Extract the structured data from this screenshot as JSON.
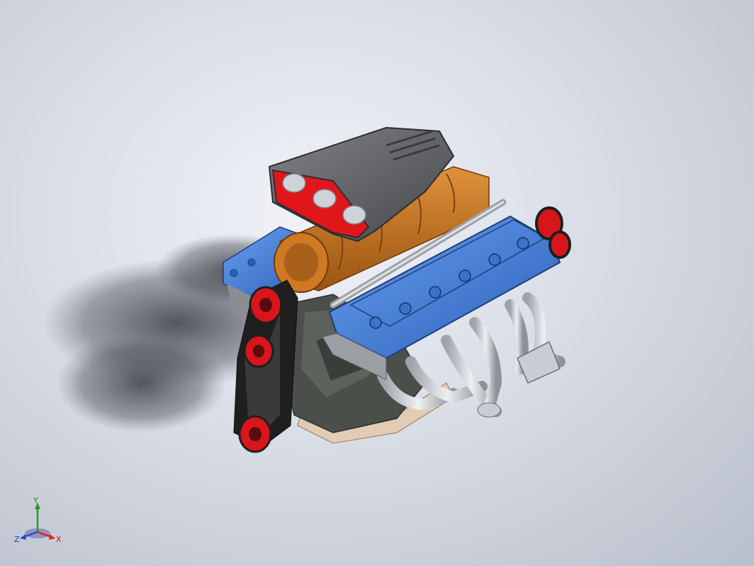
{
  "viewport": {
    "background_top": "#f1f3f8",
    "background_bottom": "#b9bfcb"
  },
  "model": {
    "colors": {
      "cylinder_head": "#3e78d6",
      "supercharger": "#c9731d",
      "scoop": "#5e6064",
      "scoop_inner": "#e0161b",
      "pulley": "#d8151b",
      "belt": "#1f1f1f",
      "block": "#4a4f4a",
      "headers": "#c9cdd3",
      "oil_pan": "#e2ccb4"
    }
  },
  "triad": {
    "x_label": "X",
    "y_label": "Y",
    "z_label": "Z",
    "x_color": "#e02020",
    "y_color": "#20a020",
    "z_color": "#2050d0"
  }
}
